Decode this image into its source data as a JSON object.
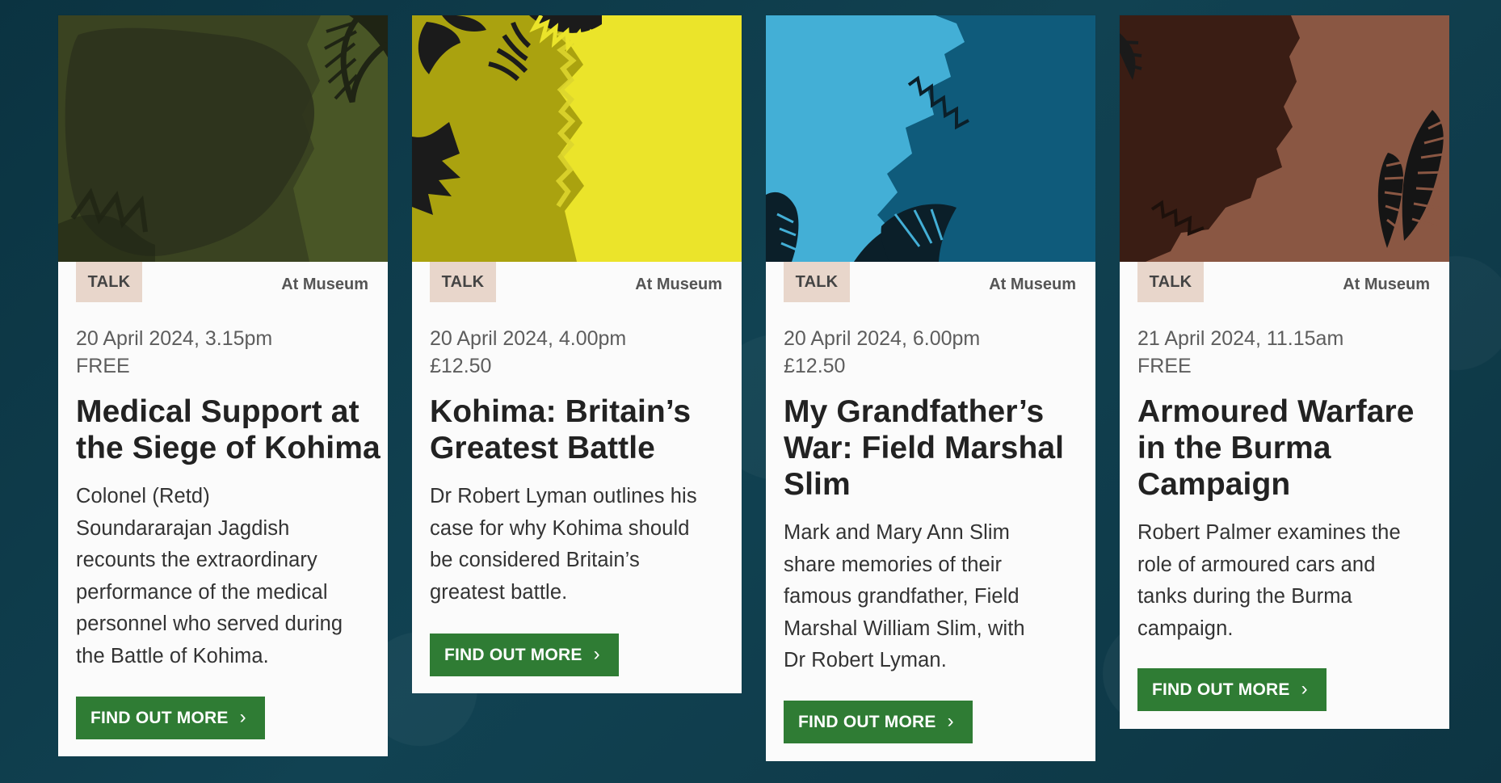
{
  "events": [
    {
      "tag": "TALK",
      "location": "At Museum",
      "date": "20 April 2024, 3.15pm",
      "price": "FREE",
      "title_lines": [
        "Medical Support at",
        "the Siege of Kohima"
      ],
      "description_lines": [
        "Colonel (Retd)",
        "Soundararajan Jagdish",
        "recounts the extraordinary",
        "performance of the medical",
        "personnel who served during",
        "the Battle of Kohima."
      ],
      "cta_label": "FIND OUT MORE",
      "cta_icon": "chevron-right-icon",
      "image_theme": {
        "left": "#5e6d2e",
        "right": "#3c4322",
        "leaf": "#1f2414"
      }
    },
    {
      "tag": "TALK",
      "location": "At Museum",
      "date": "20 April 2024, 4.00pm",
      "price": "£12.50",
      "title_lines": [
        "Kohima: Britain’s",
        "Greatest Battle"
      ],
      "description_lines": [
        "Dr Robert Lyman outlines his",
        "case for why Kohima should",
        "be considered Britain’s",
        "greatest battle."
      ],
      "cta_label": "FIND OUT MORE",
      "cta_icon": "chevron-right-icon",
      "image_theme": {
        "left": "#aaa20f",
        "right": "#ebe42a",
        "leaf": "#1b1b1b"
      }
    },
    {
      "tag": "TALK",
      "location": "At Museum",
      "date": "20 April 2024, 6.00pm",
      "price": "£12.50",
      "title_lines": [
        "My Grandfather’s",
        "War: Field Marshal",
        "Slim"
      ],
      "description_lines": [
        "Mark and Mary Ann Slim",
        "share memories of their",
        "famous grandfather, Field",
        "Marshal William Slim, with",
        "Dr Robert Lyman."
      ],
      "cta_label": "FIND OUT MORE",
      "cta_icon": "chevron-right-icon",
      "image_theme": {
        "left": "#43afd6",
        "right": "#0f5b7b",
        "leaf": "#0b1f29"
      }
    },
    {
      "tag": "TALK",
      "location": "At Museum",
      "date": "21 April 2024, 11.15am",
      "price": "FREE",
      "title_lines": [
        "Armoured Warfare",
        "in the Burma",
        "Campaign"
      ],
      "description_lines": [
        "Robert Palmer examines the",
        "role of armoured cars and",
        "tanks during the Burma",
        "campaign."
      ],
      "cta_label": "FIND OUT MORE",
      "cta_icon": "chevron-right-icon",
      "image_theme": {
        "left": "#3a1d14",
        "right": "#8a5743",
        "leaf": "#151515"
      }
    }
  ]
}
